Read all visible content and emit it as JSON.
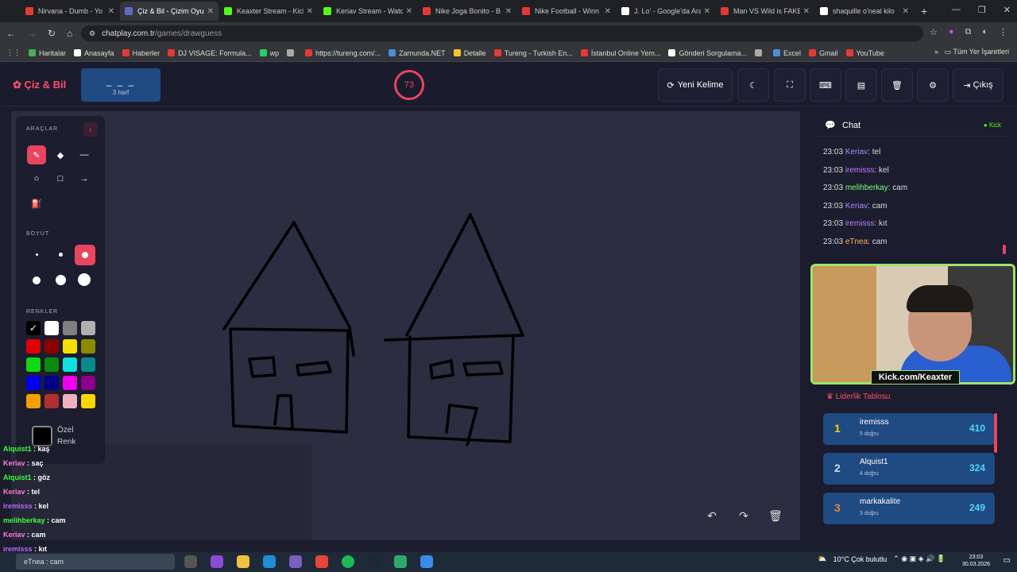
{
  "browser": {
    "tabs": [
      {
        "title": "Nirvana - Dumb - Yo",
        "color": "#e53935",
        "active": false
      },
      {
        "title": "Çiz & Bil - Çizim Oyu",
        "color": "#5c6bc0",
        "active": true
      },
      {
        "title": "Keaxter Stream - Kick",
        "color": "#53fc18",
        "active": false
      },
      {
        "title": "Keriav Stream - Watc",
        "color": "#53fc18",
        "active": false
      },
      {
        "title": "Nike Joga Bonito - B",
        "color": "#e53935",
        "active": false
      },
      {
        "title": "Nike Football - Winn",
        "color": "#e53935",
        "active": false
      },
      {
        "title": "J. Lo' - Google'da Ara",
        "color": "#ffffff",
        "active": false
      },
      {
        "title": "Man VS Wild is FAKE",
        "color": "#e53935",
        "active": false
      },
      {
        "title": "shaquille o'neal kilo",
        "color": "#ffffff",
        "active": false
      }
    ],
    "url_host": "chatplay.com.tr",
    "url_path": "/games/drawguess",
    "bookmarks": [
      {
        "label": "Haritalar",
        "color": "#4caf50"
      },
      {
        "label": "Anasayfa",
        "color": "#ffffff"
      },
      {
        "label": "Haberler",
        "color": "#e53935"
      },
      {
        "label": "DJ VISAGE: Formula...",
        "color": "#e53935"
      },
      {
        "label": "wp",
        "color": "#25d366"
      },
      {
        "label": "",
        "color": "#aaaaaa"
      },
      {
        "label": "https://tureng.com/...",
        "color": "#e53935"
      },
      {
        "label": "Zamunda.NET",
        "color": "#4a90d9"
      },
      {
        "label": "Detalle",
        "color": "#f4c430"
      },
      {
        "label": "Tureng - Turkish En...",
        "color": "#e53935"
      },
      {
        "label": "İstanbul Online Yem...",
        "color": "#e53935"
      },
      {
        "label": "Gönderi Sorgulama...",
        "color": "#ffffff"
      },
      {
        "label": "",
        "color": "#aaaaaa"
      },
      {
        "label": "Excel",
        "color": "#4a90d9"
      },
      {
        "label": "Gmail",
        "color": "#e53935"
      },
      {
        "label": "YouTube",
        "color": "#e53935"
      }
    ],
    "all_bookmarks": "Tüm Yer İşaretleri"
  },
  "game": {
    "logo": "Çiz & Bil",
    "word_blanks": "_ _ _",
    "word_hint": "3 harf",
    "timer": "73",
    "new_word": "Yeni Kelime",
    "logout": "Çıkış"
  },
  "tools": {
    "tools_title": "ARAÇLAR",
    "size_title": "BOYUT",
    "colors_title": "RENKLER",
    "custom_color_1": "Özel",
    "custom_color_2": "Renk",
    "colors": [
      "#000000",
      "#ffffff",
      "#808080",
      "#b0b0b0",
      "#e00000",
      "#8b0000",
      "#f5e000",
      "#8b8b00",
      "#12d812",
      "#0a8a0a",
      "#12e0e0",
      "#0a8a8a",
      "#0000ee",
      "#00008b",
      "#ee00ee",
      "#8b008b",
      "#f5a000",
      "#b03030",
      "#f0b0c0",
      "#f5d800"
    ]
  },
  "stream_overlay": [
    {
      "user": "Alquist1",
      "msg": "kaş",
      "color": "#3cff3c"
    },
    {
      "user": "Keriav",
      "msg": "saç",
      "color": "#ff7ad9"
    },
    {
      "user": "Alquist1",
      "msg": "göz",
      "color": "#3cff3c"
    },
    {
      "user": "Keriav",
      "msg": "tel",
      "color": "#ff7ad9"
    },
    {
      "user": "iremisss",
      "msg": "kel",
      "color": "#b26bff"
    },
    {
      "user": "melihberkay",
      "msg": "cam",
      "color": "#3cff3c"
    },
    {
      "user": "Keriav",
      "msg": "cam",
      "color": "#ff7ad9"
    },
    {
      "user": "iremisss",
      "msg": "kıt",
      "color": "#b26bff"
    }
  ],
  "chat": {
    "title": "Chat",
    "platform": "Kick",
    "messages": [
      {
        "time": "23:03",
        "user": "Keriav",
        "msg": "tel",
        "color": "#a98bff"
      },
      {
        "time": "23:03",
        "user": "iremisss",
        "msg": "kel",
        "color": "#c77dff"
      },
      {
        "time": "23:03",
        "user": "melihberkay",
        "msg": "cam",
        "color": "#7dff7a"
      },
      {
        "time": "23:03",
        "user": "Keriav",
        "msg": "cam",
        "color": "#a98bff"
      },
      {
        "time": "23:03",
        "user": "iremisss",
        "msg": "kıt",
        "color": "#c77dff"
      },
      {
        "time": "23:03",
        "user": "eTnea",
        "msg": "cam",
        "color": "#ffb060"
      }
    ]
  },
  "webcam_label": "Kick.com/Keaxter",
  "leaderboard": {
    "title": "Liderlik Tablosu",
    "rows": [
      {
        "rank": "1",
        "name": "iremisss",
        "sub": "5 doğru",
        "points": "410",
        "rank_color": "#f5d000"
      },
      {
        "rank": "2",
        "name": "Alquist1",
        "sub": "4 doğru",
        "points": "324",
        "rank_color": "#d0d8e8"
      },
      {
        "rank": "3",
        "name": "markakalite",
        "sub": "3 doğru",
        "points": "249",
        "rank_color": "#e08a3a"
      }
    ]
  },
  "taskbar": {
    "search_user": "eTnea",
    "search_msg": "cam",
    "weather": "10°C  Çok bulutlu",
    "time": "23:03",
    "date": "30.03.2026"
  }
}
